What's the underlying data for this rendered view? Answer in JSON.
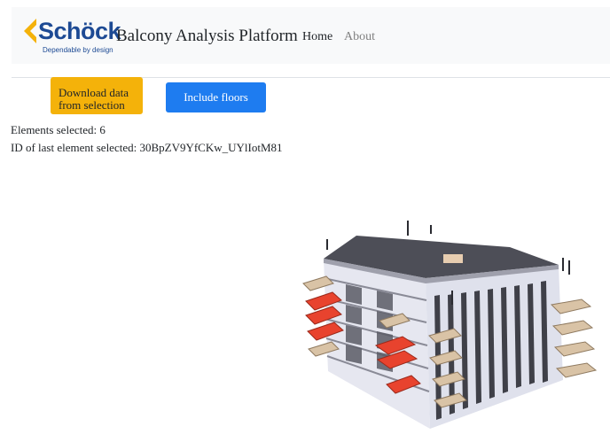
{
  "navbar": {
    "logo_word": "Schöck",
    "logo_tagline": "Dependable by design",
    "brand": "Balcony Analysis Platform",
    "links": [
      {
        "label": "Home",
        "active": true
      },
      {
        "label": "About",
        "active": false
      }
    ]
  },
  "actions": {
    "download_label": "Download data from selection",
    "include_label": "Include floors"
  },
  "selection": {
    "elements_selected_text": "Elements selected: 6",
    "last_id_text": "ID of last element selected: 30BpZV9YfCKw_UYlIotM81"
  },
  "colors": {
    "brand_blue": "#1d4a94",
    "logo_yellow": "#f4b20a",
    "primary_button": "#1e7cf0",
    "warning_button": "#f4b20a",
    "highlight_red": "#e8432e"
  },
  "viewer": {
    "icon": "3d-building-model"
  }
}
